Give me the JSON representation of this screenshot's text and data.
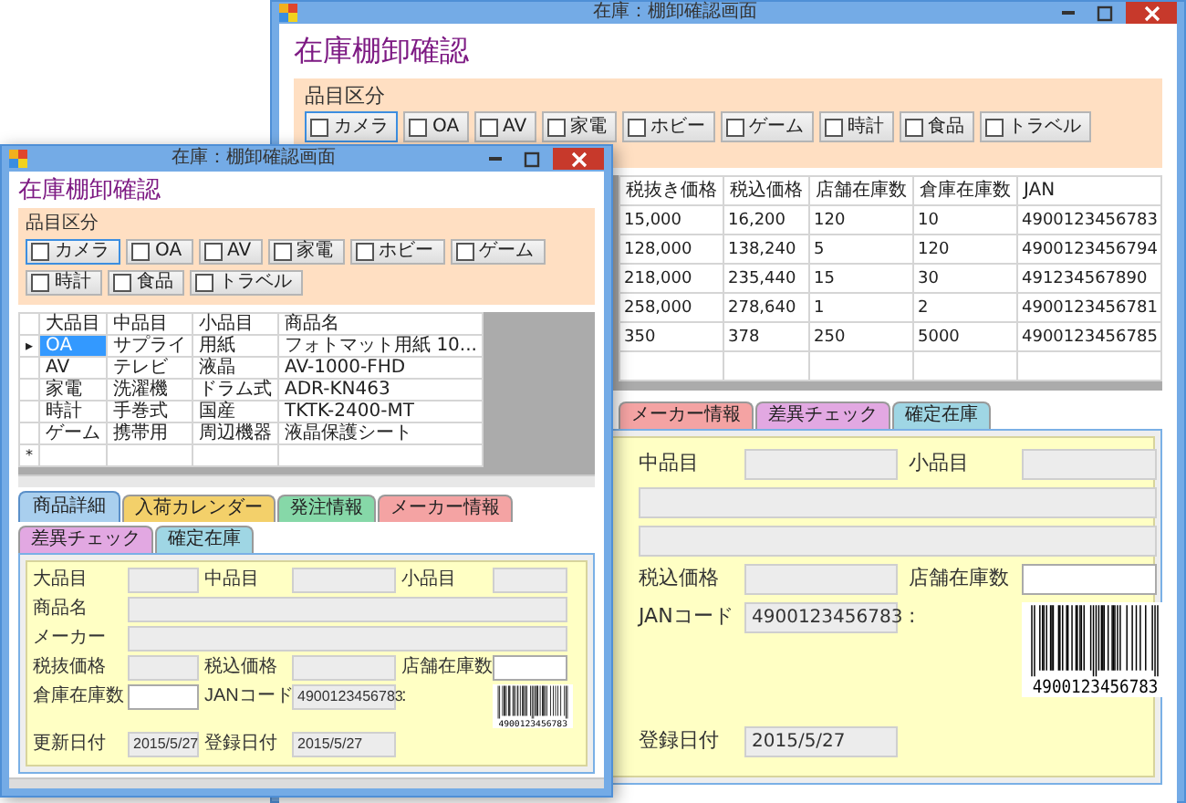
{
  "windows": [
    {
      "title": "在庫：棚卸確認画面",
      "heading": "在庫棚卸確認",
      "group": {
        "label": "品目区分",
        "options": [
          {
            "label": "カメラ",
            "checked": false,
            "focused": true
          },
          {
            "label": "OA",
            "checked": false,
            "focused": false
          },
          {
            "label": "AV",
            "checked": false,
            "focused": false
          },
          {
            "label": "家電",
            "checked": false,
            "focused": false
          },
          {
            "label": "ホビー",
            "checked": false,
            "focused": false
          },
          {
            "label": "ゲーム",
            "checked": false,
            "focused": false
          },
          {
            "label": "時計",
            "checked": false,
            "focused": false
          },
          {
            "label": "食品",
            "checked": false,
            "focused": false
          },
          {
            "label": "トラベル",
            "checked": false,
            "focused": false
          }
        ]
      },
      "table": {
        "columns": [
          "税抜き価格",
          "税込価格",
          "店舗在庫数",
          "倉庫在庫数",
          "JAN"
        ],
        "rows": [
          {
            "kind": "data",
            "cells": [
              "15,000",
              "16,200",
              "120",
              "10",
              "4900123456783"
            ]
          },
          {
            "kind": "data",
            "cells": [
              "128,000",
              "138,240",
              "5",
              "120",
              "4900123456794"
            ]
          },
          {
            "kind": "data",
            "cells": [
              "218,000",
              "235,440",
              "15",
              "30",
              "491234567890"
            ]
          },
          {
            "kind": "data",
            "cells": [
              "258,000",
              "278,640",
              "1",
              "2",
              "4900123456781"
            ]
          },
          {
            "kind": "data",
            "cells": [
              "350",
              "378",
              "250",
              "5000",
              "4900123456785"
            ]
          },
          {
            "kind": "new"
          }
        ]
      },
      "tabs": [
        {
          "label": "メーカー情報",
          "color": "#f4a3a3",
          "selected": false
        },
        {
          "label": "差異チェック",
          "color": "#e2a8e2",
          "selected": false
        },
        {
          "label": "確定在庫",
          "color": "#9fd6e4",
          "selected": false
        }
      ],
      "detail": {
        "rows": [
          {
            "kind": "full",
            "cells": [
              {
                "kind": "label",
                "text": "中品目"
              },
              {
                "kind": "field"
              },
              {
                "kind": "label",
                "text": "小品目"
              },
              {
                "kind": "field"
              }
            ]
          },
          {
            "kind": "full",
            "cells": [
              {
                "kind": "wide-field"
              }
            ]
          },
          {
            "kind": "full",
            "cells": [
              {
                "kind": "wide-field"
              }
            ]
          },
          {
            "kind": "full",
            "cells": [
              {
                "kind": "label",
                "text": "税込価格"
              },
              {
                "kind": "field"
              },
              {
                "kind": "label",
                "text": "店舗在庫数"
              },
              {
                "kind": "input"
              }
            ]
          },
          {
            "kind": "full",
            "cells": [
              {
                "kind": "label",
                "text": "JANコード"
              },
              {
                "kind": "value",
                "text": "4900123456783"
              },
              {
                "kind": "label",
                "text": ":"
              },
              {
                "kind": "barcode",
                "text": "4900123456783"
              }
            ]
          },
          {
            "kind": "short",
            "cells": [
              {
                "kind": "label",
                "text": "登録日付"
              },
              {
                "kind": "value",
                "text": "2015/5/27"
              }
            ]
          }
        ]
      }
    },
    {
      "title": "在庫：棚卸確認画面",
      "heading": "在庫棚卸確認",
      "group": {
        "label": "品目区分",
        "options": [
          {
            "label": "カメラ",
            "checked": false,
            "focused": true
          },
          {
            "label": "OA",
            "checked": false,
            "focused": false
          },
          {
            "label": "AV",
            "checked": false,
            "focused": false
          },
          {
            "label": "家電",
            "checked": false,
            "focused": false
          },
          {
            "label": "ホビー",
            "checked": false,
            "focused": false
          },
          {
            "label": "ゲーム",
            "checked": false,
            "focused": false
          },
          {
            "label": "時計",
            "checked": false,
            "focused": false
          },
          {
            "label": "食品",
            "checked": false,
            "focused": false
          },
          {
            "label": "トラベル",
            "checked": false,
            "focused": false
          }
        ]
      },
      "table": {
        "columns": [
          "大品目",
          "中品目",
          "小品目",
          "商品名"
        ],
        "rows": [
          {
            "kind": "data",
            "marker": "▸",
            "cells": [
              {
                "text": "OA",
                "selected": true
              },
              {
                "text": "サプライ",
                "selected": false
              },
              {
                "text": "用紙",
                "selected": false
              },
              {
                "text": "フォトマット用紙 10...",
                "selected": false
              }
            ]
          },
          {
            "kind": "data",
            "cells": [
              {
                "text": "AV",
                "selected": false
              },
              {
                "text": "テレビ",
                "selected": false
              },
              {
                "text": "液晶",
                "selected": false
              },
              {
                "text": "AV-1000-FHD",
                "selected": false
              }
            ]
          },
          {
            "kind": "data",
            "cells": [
              {
                "text": "家電",
                "selected": false
              },
              {
                "text": "洗濯機",
                "selected": false
              },
              {
                "text": "ドラム式",
                "selected": false
              },
              {
                "text": "ADR-KN463",
                "selected": false
              }
            ]
          },
          {
            "kind": "data",
            "cells": [
              {
                "text": "時計",
                "selected": false
              },
              {
                "text": "手巻式",
                "selected": false
              },
              {
                "text": "国産",
                "selected": false
              },
              {
                "text": "TKTK-2400-MT",
                "selected": false
              }
            ]
          },
          {
            "kind": "data",
            "cells": [
              {
                "text": "ゲーム",
                "selected": false
              },
              {
                "text": "携帯用",
                "selected": false
              },
              {
                "text": "周辺機器",
                "selected": false
              },
              {
                "text": "液晶保護シート",
                "selected": false
              }
            ]
          },
          {
            "kind": "new",
            "marker": "*"
          }
        ]
      },
      "tabs": [
        {
          "label": "商品詳細",
          "color": "#a9cfee",
          "selected": true
        },
        {
          "label": "入荷カレンダー",
          "color": "#f3d06a",
          "selected": false
        },
        {
          "label": "発注情報",
          "color": "#86d8a8",
          "selected": false
        },
        {
          "label": "メーカー情報",
          "color": "#f4a3a3",
          "selected": false
        },
        {
          "label": "差異チェック",
          "color": "#e2a8e2",
          "selected": false
        },
        {
          "label": "確定在庫",
          "color": "#9fd6e4",
          "selected": false
        }
      ],
      "detail": {
        "rows": [
          {
            "kind": "full",
            "cells": [
              {
                "kind": "label",
                "text": "大品目"
              },
              {
                "kind": "field"
              },
              {
                "kind": "label",
                "text": "中品目"
              },
              {
                "kind": "field"
              },
              {
                "kind": "label",
                "text": "小品目"
              },
              {
                "kind": "field"
              }
            ]
          },
          {
            "kind": "full",
            "cells": [
              {
                "kind": "label",
                "text": "商品名"
              },
              {
                "kind": "wide-field"
              }
            ]
          },
          {
            "kind": "full",
            "cells": [
              {
                "kind": "label",
                "text": "メーカー"
              },
              {
                "kind": "wide-field"
              }
            ]
          },
          {
            "kind": "full",
            "cells": [
              {
                "kind": "label",
                "text": "税抜価格"
              },
              {
                "kind": "field"
              },
              {
                "kind": "label",
                "text": "税込価格"
              },
              {
                "kind": "field"
              },
              {
                "kind": "label",
                "text": "店舗在庫数"
              },
              {
                "kind": "input"
              }
            ]
          },
          {
            "kind": "full",
            "cells": [
              {
                "kind": "label",
                "text": "倉庫在庫数"
              },
              {
                "kind": "input"
              },
              {
                "kind": "label",
                "text": "JANコード"
              },
              {
                "kind": "value",
                "text": "4900123456783"
              },
              {
                "kind": "label",
                "text": ":"
              },
              {
                "kind": "barcode",
                "text": "4900123456783"
              }
            ]
          },
          {
            "kind": "short",
            "cells": [
              {
                "kind": "label",
                "text": "更新日付"
              },
              {
                "kind": "value",
                "text": "2015/5/27"
              },
              {
                "kind": "label",
                "text": "登録日付"
              },
              {
                "kind": "value",
                "text": "2015/5/27"
              }
            ]
          }
        ]
      }
    }
  ]
}
